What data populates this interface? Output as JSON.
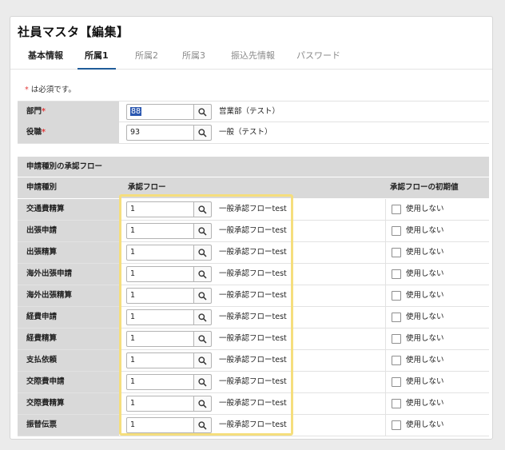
{
  "page": {
    "title": "社員マスタ【編集】"
  },
  "tabs": [
    {
      "label": "基本情報",
      "active": false
    },
    {
      "label": "所属1",
      "active": true
    },
    {
      "label": "所属2",
      "active": false
    },
    {
      "label": "所属3",
      "active": false
    },
    {
      "label": "振込先情報",
      "active": false
    },
    {
      "label": "パスワード",
      "active": false
    }
  ],
  "required_note": {
    "mark": "*",
    "text": "は必須です。"
  },
  "fields": {
    "department": {
      "label": "部門",
      "required_mark": "*",
      "value": "88",
      "display": "営業部（テスト）"
    },
    "position": {
      "label": "役職",
      "required_mark": "*",
      "value": "93",
      "display": "一般（テスト）"
    }
  },
  "approval": {
    "section_title": "申請種別の承認フロー",
    "columns": {
      "type": "申請種別",
      "flow": "承認フロー",
      "default": "承認フローの初期値"
    },
    "checkbox_label": "使用しない",
    "rows": [
      {
        "type": "交通費精算",
        "flow_value": "1",
        "flow_name": "一般承認フローtest"
      },
      {
        "type": "出張申請",
        "flow_value": "1",
        "flow_name": "一般承認フローtest"
      },
      {
        "type": "出張精算",
        "flow_value": "1",
        "flow_name": "一般承認フローtest"
      },
      {
        "type": "海外出張申請",
        "flow_value": "1",
        "flow_name": "一般承認フローtest"
      },
      {
        "type": "海外出張精算",
        "flow_value": "1",
        "flow_name": "一般承認フローtest"
      },
      {
        "type": "経費申請",
        "flow_value": "1",
        "flow_name": "一般承認フローtest"
      },
      {
        "type": "経費精算",
        "flow_value": "1",
        "flow_name": "一般承認フローtest"
      },
      {
        "type": "支払依頼",
        "flow_value": "1",
        "flow_name": "一般承認フローtest"
      },
      {
        "type": "交際費申請",
        "flow_value": "1",
        "flow_name": "一般承認フローtest"
      },
      {
        "type": "交際費精算",
        "flow_value": "1",
        "flow_name": "一般承認フローtest"
      },
      {
        "type": "振替伝票",
        "flow_value": "1",
        "flow_name": "一般承認フローtest"
      }
    ]
  },
  "colors": {
    "tab_underline": "#1f5c99",
    "required": "#e23a3a",
    "highlight": "#f5de7d",
    "header_bg": "#d9d9d9"
  }
}
